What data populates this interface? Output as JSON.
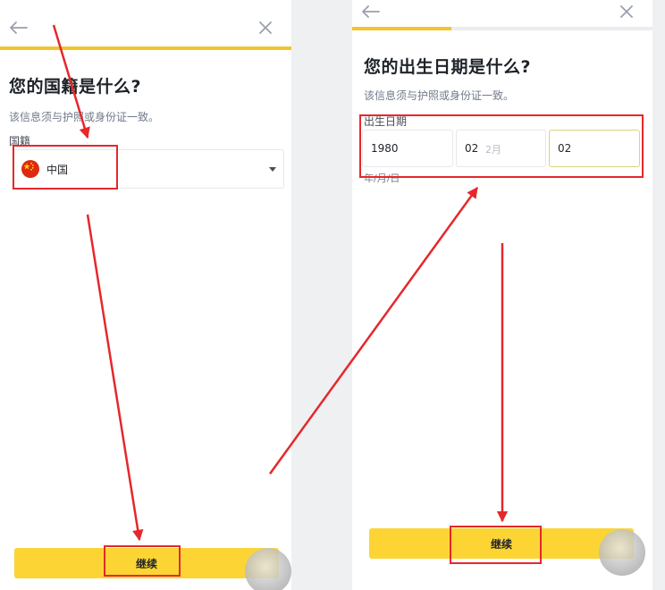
{
  "left_screen": {
    "title": "您的国籍是什么?",
    "subtitle": "该信息须与护照或身份证一致。",
    "field_label": "国籍",
    "selected_country": "中国",
    "flag_icon": "china-flag-icon",
    "continue_label": "继续",
    "progress": 1.0
  },
  "right_screen": {
    "title": "您的出生日期是什么?",
    "subtitle": "该信息须与护照或身份证一致。",
    "field_label": "出生日期",
    "year_value": "1980",
    "month_value": "02",
    "month_hint": "2月",
    "day_value": "02",
    "format_hint": "年/月/日",
    "continue_label": "继续",
    "progress": 0.33
  },
  "colors": {
    "accent": "#fcd535",
    "progress": "#f0c62c",
    "annotation": "#e5282b"
  }
}
